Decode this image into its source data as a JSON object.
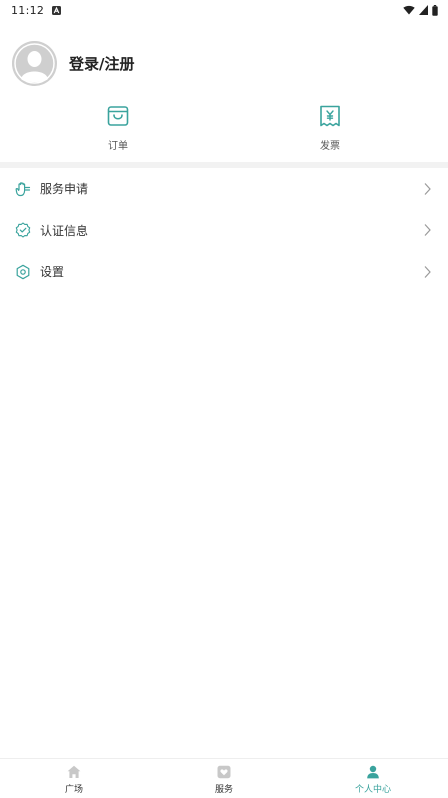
{
  "status_bar": {
    "time": "11:12",
    "notification_icon": "a-badge-icon",
    "icons": [
      "wifi-icon",
      "cell-signal-icon",
      "battery-icon"
    ]
  },
  "profile": {
    "login_label": "登录/注册",
    "avatar_icon": "default-avatar-icon"
  },
  "quick_actions": {
    "order_label": "订单",
    "order_icon": "shopping-bag-icon",
    "invoice_label": "发票",
    "invoice_icon": "invoice-icon"
  },
  "menu": {
    "items": [
      {
        "label": "服务申请",
        "icon": "hand-icon"
      },
      {
        "label": "认证信息",
        "icon": "verified-badge-icon"
      },
      {
        "label": "设置",
        "icon": "settings-hexagon-icon"
      }
    ]
  },
  "bottom_nav": {
    "items": [
      {
        "label": "广场",
        "icon": "home-icon"
      },
      {
        "label": "服务",
        "icon": "heart-box-icon"
      },
      {
        "label": "个人中心",
        "icon": "person-icon"
      }
    ],
    "active_index": 2
  },
  "colors": {
    "accent": "#3aa39d",
    "inactive_icon": "#c8c8c8",
    "band": "#f2f2f2"
  }
}
